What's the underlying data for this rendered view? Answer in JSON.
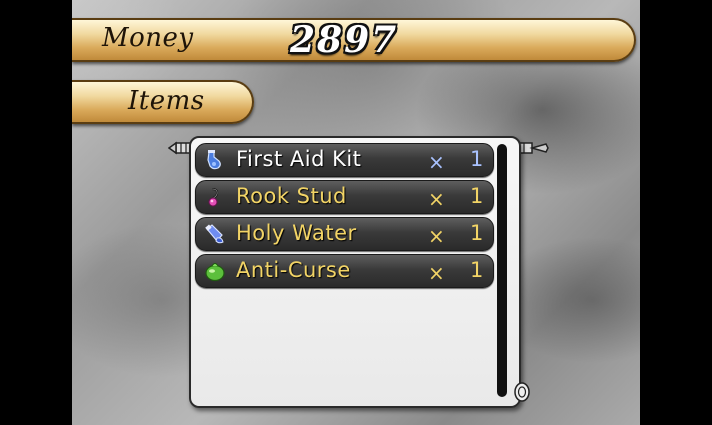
{
  "header": {
    "money_label": "Money",
    "money_value": "2897",
    "items_label": "Items"
  },
  "items": [
    {
      "name": "First Aid Kit",
      "multiplier": "×",
      "qty": "1",
      "icon": "potion-bottle-icon",
      "color": "#ffffff"
    },
    {
      "name": "Rook Stud",
      "multiplier": "×",
      "qty": "1",
      "icon": "earring-icon",
      "color": "#f2d466"
    },
    {
      "name": "Holy Water",
      "multiplier": "×",
      "qty": "1",
      "icon": "holy-water-icon",
      "color": "#f2d466"
    },
    {
      "name": "Anti-Curse",
      "multiplier": "×",
      "qty": "1",
      "icon": "anti-curse-icon",
      "color": "#f2d466"
    }
  ]
}
